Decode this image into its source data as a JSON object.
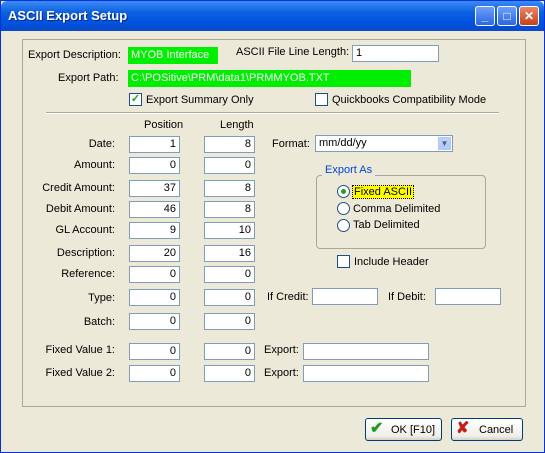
{
  "window": {
    "title": "ASCII Export Setup"
  },
  "header": {
    "export_description_label": "Export Description:",
    "export_description_value": "MYOB Interface",
    "line_length_label": "ASCII File  Line Length:",
    "line_length_value": "1",
    "export_path_label": "Export Path:",
    "export_path_value": "C:\\POSitive\\PRM\\data1\\PRMMYOB.TXT",
    "export_summary_label": "Export Summary Only",
    "export_summary_checked": true,
    "quickbooks_label": "Quickbooks Compatibility Mode",
    "quickbooks_checked": false
  },
  "columns": {
    "position": "Position",
    "length": "Length"
  },
  "fields": [
    {
      "label": "Date:",
      "position": "1",
      "length": "8"
    },
    {
      "label": "Amount:",
      "position": "0",
      "length": "0"
    },
    {
      "label": "Credit Amount:",
      "position": "37",
      "length": "8"
    },
    {
      "label": "Debit Amount:",
      "position": "46",
      "length": "8"
    },
    {
      "label": "GL Account:",
      "position": "9",
      "length": "10"
    },
    {
      "label": "Description:",
      "position": "20",
      "length": "16"
    },
    {
      "label": "Reference:",
      "position": "0",
      "length": "0"
    },
    {
      "label": "Type:",
      "position": "0",
      "length": "0"
    },
    {
      "label": "Batch:",
      "position": "0",
      "length": "0"
    }
  ],
  "fixed": [
    {
      "label": "Fixed Value 1:",
      "position": "0",
      "length": "0",
      "export_label": "Export:",
      "export_value": ""
    },
    {
      "label": "Fixed Value 2:",
      "position": "0",
      "length": "0",
      "export_label": "Export:",
      "export_value": ""
    }
  ],
  "format": {
    "label": "Format:",
    "value": "mm/dd/yy"
  },
  "export_as": {
    "title": "Export As",
    "options": [
      "Fixed ASCII",
      "Comma Delimited",
      "Tab Delimited"
    ],
    "selected": "Fixed ASCII"
  },
  "include_header": {
    "label": "Include Header",
    "checked": false
  },
  "type_extra": {
    "if_credit_label": "If Credit:",
    "if_credit_value": "",
    "if_debit_label": "If Debit:",
    "if_debit_value": ""
  },
  "buttons": {
    "ok": "OK [F10]",
    "cancel": "Cancel"
  },
  "colors": {
    "title_bar": "#0a5fe0",
    "highlight_green": "#00ee00",
    "selected_option": "#ffff00"
  }
}
